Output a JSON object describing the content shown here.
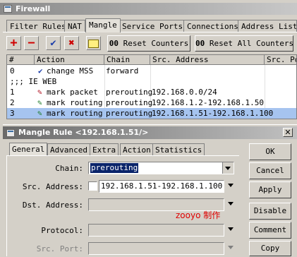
{
  "window": {
    "title": "Firewall"
  },
  "tabs": [
    "Filter Rules",
    "NAT",
    "Mangle",
    "Service Ports",
    "Connections",
    "Address Lists"
  ],
  "toolbar": {
    "add_icon": "+",
    "remove_icon": "−",
    "enable_icon": "✔",
    "disable_icon": "✖",
    "comment_icon": "comment-icon",
    "reset_counters": "Reset Counters",
    "reset_all_counters": "Reset All Counters",
    "counter_icon": "00"
  },
  "grid": {
    "columns": [
      "#",
      "Action",
      "Chain",
      "Src. Address",
      "Src. Po"
    ],
    "rows": [
      {
        "num": "0",
        "action": "change MSS",
        "chain": "forward",
        "src": "",
        "type": "rule",
        "icon": "check-icon"
      },
      {
        "comment": ";;; IE WEB",
        "type": "comment"
      },
      {
        "num": "1",
        "action": "mark packet",
        "chain": "prerouting",
        "src": "192.168.0.0/24",
        "type": "rule",
        "icon": "pen-icon"
      },
      {
        "num": "2",
        "action": "mark routing",
        "chain": "prerouting",
        "src": "192.168.1.2-192.168.1.50",
        "type": "rule",
        "icon": "pen-icon"
      },
      {
        "num": "3",
        "action": "mark routing",
        "chain": "prerouting",
        "src": "192.168.1.51-192.168.1.100",
        "type": "rule",
        "icon": "pen-icon",
        "selected": true
      }
    ]
  },
  "dialog": {
    "title": "Mangle Rule <192.168.1.51/>",
    "tabs": [
      "General",
      "Advanced",
      "Extra",
      "Action",
      "Statistics"
    ],
    "fields": {
      "chain_label": "Chain:",
      "chain_value": "prerouting",
      "src_label": "Src. Address:",
      "src_value": "192.168.1.51-192.168.1.100",
      "dst_label": "Dst. Address:",
      "dst_value": "",
      "protocol_label": "Protocol:",
      "protocol_value": "",
      "src_port_label": "Src. Port:",
      "src_port_value": ""
    },
    "watermark": "zooyo 制作",
    "buttons": {
      "ok": "OK",
      "cancel": "Cancel",
      "apply": "Apply",
      "disable": "Disable",
      "comment": "Comment",
      "copy": "Copy"
    }
  }
}
